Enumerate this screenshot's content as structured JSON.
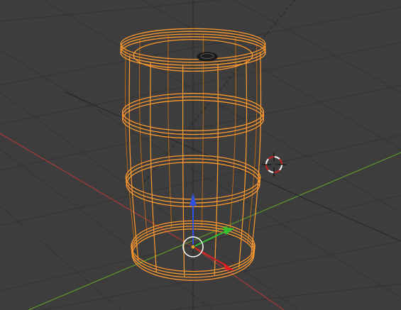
{
  "viewport": {
    "background": "#3d3d3d",
    "grid_color": "#333333",
    "x_axis_color": "#a83a3a",
    "y_axis_color": "#5d9a2c",
    "z_axis_color": "#2e2e2e"
  },
  "object": {
    "type": "barrel",
    "display": "wireframe",
    "selected": true,
    "wire_color": "#ff9a2e",
    "wire_dark_color": "#b56618",
    "vertical_struts": 12,
    "hoops": 3
  },
  "gizmo": {
    "x_arrow_color": "#e02020",
    "y_arrow_color": "#30c030",
    "z_arrow_color": "#3050e0",
    "origin_color": "#e0a030",
    "ring_color": "#ffffff"
  },
  "cursor_3d": {
    "ring_color_a": "#ffffff",
    "ring_color_b": "#d02020",
    "crosshair_color": "#101010"
  },
  "icons": {
    "transform_gizmo": "move-manipulator-icon",
    "cursor": "3d-cursor-icon",
    "object_origin": "origin-dot-icon"
  }
}
